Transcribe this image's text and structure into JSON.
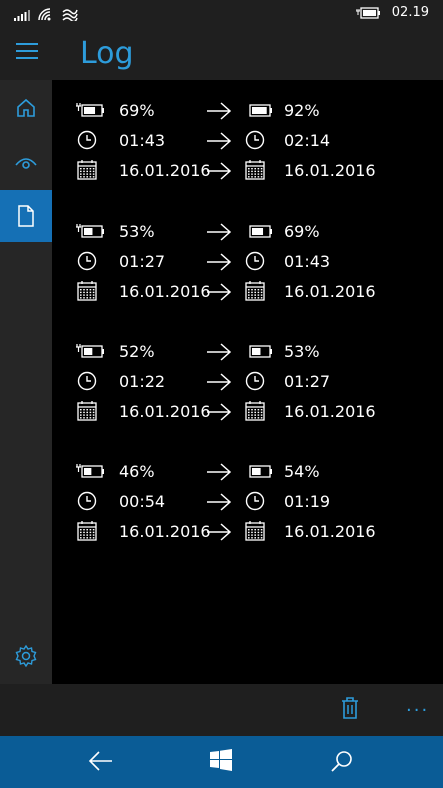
{
  "status": {
    "time": "02.19"
  },
  "header": {
    "title": "Log"
  },
  "entries": [
    {
      "from_pct": "69%",
      "to_pct": "92%",
      "from_time": "01:43",
      "to_time": "02:14",
      "from_date": "16.01.2016",
      "to_date": "16.01.2016",
      "from_fill": 0.69,
      "to_fill": 0.92
    },
    {
      "from_pct": "53%",
      "to_pct": "69%",
      "from_time": "01:27",
      "to_time": "01:43",
      "from_date": "16.01.2016",
      "to_date": "16.01.2016",
      "from_fill": 0.53,
      "to_fill": 0.69
    },
    {
      "from_pct": "52%",
      "to_pct": "53%",
      "from_time": "01:22",
      "to_time": "01:27",
      "from_date": "16.01.2016",
      "to_date": "16.01.2016",
      "from_fill": 0.52,
      "to_fill": 0.53
    },
    {
      "from_pct": "46%",
      "to_pct": "54%",
      "from_time": "00:54",
      "to_time": "01:19",
      "from_date": "16.01.2016",
      "to_date": "16.01.2016",
      "from_fill": 0.46,
      "to_fill": 0.54
    }
  ],
  "appbar": {
    "more_label": "···"
  },
  "colors": {
    "accent": "#2d9cdb",
    "active_nav": "#1570b5",
    "navbar": "#0a5c96"
  }
}
